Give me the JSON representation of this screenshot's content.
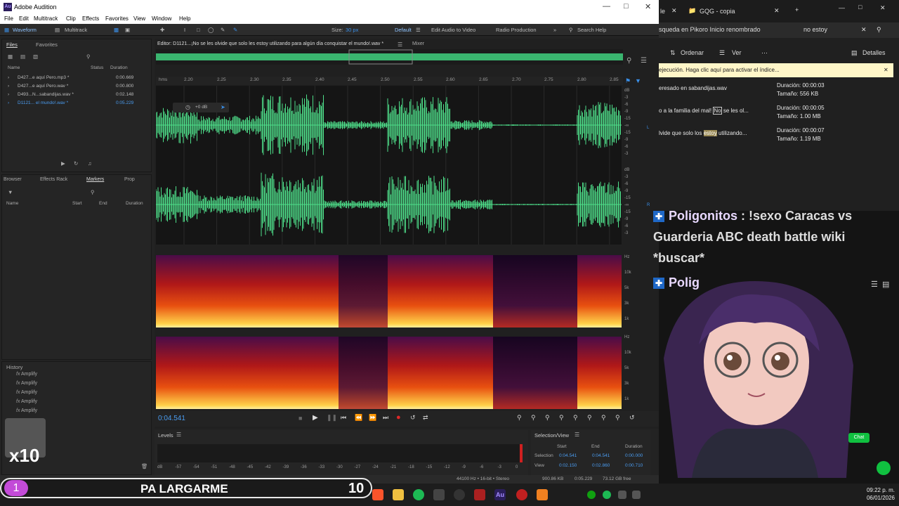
{
  "audition": {
    "title": "Adobe Audition",
    "logo": "Au",
    "menu": [
      "File",
      "Edit",
      "Multitrack",
      "Clip",
      "Effects",
      "Favorites",
      "View",
      "Window",
      "Help"
    ],
    "toolbar": {
      "waveform": "Waveform",
      "multitrack": "Multitrack",
      "size_label": "Size:",
      "size_value": "30 px",
      "workspace": "Default",
      "edit_video": "Edit Audio to Video",
      "radio": "Radio Production",
      "search_placeholder": "Search Help"
    },
    "files_panel": {
      "tabs": [
        "Files",
        "Favorites"
      ],
      "columns": [
        "Name",
        "Status",
        "Duration"
      ],
      "rows": [
        {
          "name": "D427...e aquí Pero.mp3 *",
          "duration": "0:00.669"
        },
        {
          "name": "D427...e aquí Pero.wav *",
          "duration": "0:00.800"
        },
        {
          "name": "D493...N...sabandijas.wav *",
          "duration": "0:02.148"
        },
        {
          "name": "D1121... el mundo!.wav *",
          "duration": "0:05.229"
        }
      ]
    },
    "markers_panel": {
      "tabs": [
        "Browser",
        "Effects Rack",
        "Markers",
        "Prop"
      ],
      "columns": [
        "Name",
        "Start",
        "End",
        "Duration"
      ]
    },
    "history_panel": {
      "title": "History",
      "items": [
        "Amplify",
        "Amplify",
        "Amplify",
        "Amplify",
        "Amplify"
      ]
    },
    "editor": {
      "tab": "Editor: D1121...¡No se les olvide que solo les estoy utilizando para algún día conquistar el mundo!.wav *",
      "mixer": "Mixer",
      "hud_db": "+0 dB",
      "ruler_unit": "hms",
      "ruler_ticks": [
        "2.20",
        "2.25",
        "2.30",
        "2.35",
        "2.40",
        "2.45",
        "2.50",
        "2.55",
        "2.60",
        "2.65",
        "2.70",
        "2.75",
        "2.80",
        "2.85"
      ],
      "db_scale": [
        "dB",
        "-3",
        "-6",
        "-9",
        "-15",
        "-∞",
        "-15",
        "-9",
        "-6",
        "-3"
      ],
      "hz_scale": [
        "Hz",
        "10k",
        "5k",
        "3k",
        "1k"
      ],
      "channel_l": "L",
      "channel_r": "R"
    },
    "transport": {
      "time": "0:04.541"
    },
    "levels": {
      "title": "Levels",
      "scale": [
        "dB",
        "-57",
        "-54",
        "-51",
        "-48",
        "-45",
        "-42",
        "-39",
        "-36",
        "-33",
        "-30",
        "-27",
        "-24",
        "-21",
        "-18",
        "-15",
        "-12",
        "-9",
        "-6",
        "-3",
        "0"
      ]
    },
    "selection_view": {
      "title": "Selection/View",
      "cols": [
        "Start",
        "End",
        "Duration"
      ],
      "selection": {
        "label": "Selection",
        "start": "0:04.541",
        "end": "0:04.541",
        "duration": "0:00.000"
      },
      "view": {
        "label": "View",
        "start": "0:02.150",
        "end": "0:02.860",
        "duration": "0:00.710"
      }
    },
    "status": {
      "format": "44100 Hz • 16-bit • Stereo",
      "size": "900.86 KB",
      "duration": "0:05.229",
      "free": "73.12 GB free"
    }
  },
  "explorer": {
    "tab": "GQG - copia",
    "left_tab_frag": "le",
    "address": "squeda en Pikoro Inicio renombrado",
    "search": "no estoy",
    "cmd": {
      "sort": "Ordenar",
      "view": "Ver",
      "details": "Detalles"
    },
    "info_bar": "ejecución. Haga clic aquí para activar el índice...",
    "rows": [
      {
        "name_pre": "eresado en sabandijas.wav",
        "name_hl": "",
        "name_post": "",
        "duration": "Duración: 00:00:03",
        "size": "Tamaño: 556 KB"
      },
      {
        "name_pre": "o a la familia del mal! ",
        "name_hl": "No",
        "name_post": " se les ol...",
        "duration": "Duración: 00:00:05",
        "size": "Tamaño: 1.00 MB"
      },
      {
        "name_pre": "lvide que solo los ",
        "name_hl": "estoy",
        "name_post": " utilizando...",
        "duration": "Duración: 00:00:07",
        "size": "Tamaño: 1.19 MB"
      }
    ]
  },
  "chat": [
    {
      "name": "Poligonitos",
      "message": " : !sexo Caracas vs"
    },
    {
      "line": "Guarderia ABC death battle wiki"
    },
    {
      "line": "*buscar*"
    },
    {
      "name": "Polig",
      "message": ""
    }
  ],
  "overlay": {
    "multiplier": "x10",
    "goal_count": "1",
    "goal_text": "PA LARGARME",
    "goal_target": "10",
    "chat_btn": "Chat"
  },
  "clock": {
    "time": "09:22 p. m.",
    "date": "06/01/2026"
  },
  "colors": {
    "waveform": "#4ee08a",
    "accent": "#3a8fe8",
    "spectrum_hot": "#ffd24a"
  }
}
